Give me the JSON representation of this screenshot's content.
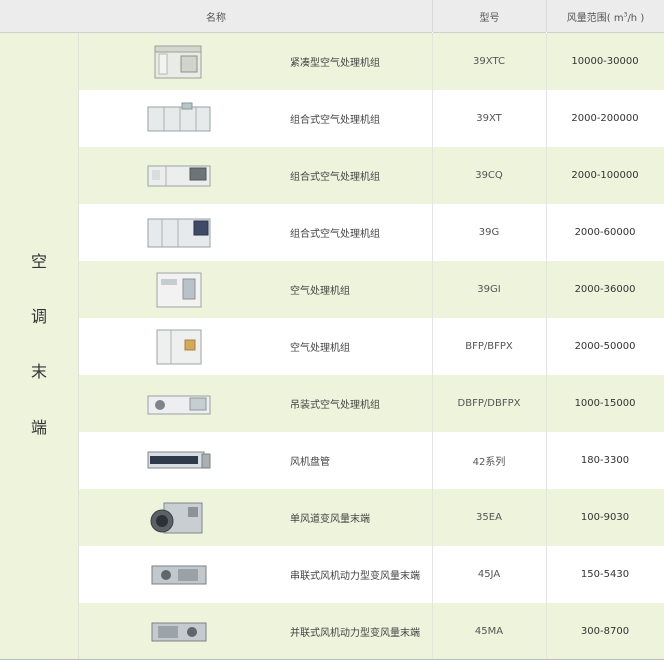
{
  "header": {
    "name_label": "名称",
    "model_label": "型号",
    "flow_label": "风量范围(",
    "flow_unit": "m",
    "flow_sup": "3",
    "flow_tail": "/h )"
  },
  "category": {
    "chars": [
      "空",
      "调",
      "末",
      "端"
    ]
  },
  "rows": [
    {
      "name": "紧凑型空气处理机组",
      "model": "39XTC",
      "flow": "10000-30000",
      "icon": "compact-air-handler-icon"
    },
    {
      "name": "组合式空气处理机组",
      "model": "39XT",
      "flow": "2000-200000",
      "icon": "modular-air-handler-icon"
    },
    {
      "name": "组合式空气处理机组",
      "model": "39CQ",
      "flow": "2000-100000",
      "icon": "modular-air-handler-icon"
    },
    {
      "name": "组合式空气处理机组",
      "model": "39G",
      "flow": "2000-60000",
      "icon": "modular-air-handler-icon"
    },
    {
      "name": "空气处理机组",
      "model": "39GI",
      "flow": "2000-36000",
      "icon": "air-handler-icon"
    },
    {
      "name": "空气处理机组",
      "model": "BFP/BFPX",
      "flow": "2000-50000",
      "icon": "air-handler-icon"
    },
    {
      "name": "吊装式空气处理机组",
      "model": "DBFP/DBFPX",
      "flow": "1000-15000",
      "icon": "ceiling-air-handler-icon"
    },
    {
      "name": "风机盘管",
      "model": "42系列",
      "flow": "180-3300",
      "icon": "fan-coil-icon"
    },
    {
      "name": "单风道变风量末端",
      "model": "35EA",
      "flow": "100-9030",
      "icon": "vav-terminal-icon"
    },
    {
      "name": "串联式风机动力型变风量末端",
      "model": "45JA",
      "flow": "150-5430",
      "icon": "series-fan-vav-icon"
    },
    {
      "name": "并联式风机动力型变风量末端",
      "model": "45MA",
      "flow": "300-8700",
      "icon": "parallel-fan-vav-icon"
    }
  ]
}
